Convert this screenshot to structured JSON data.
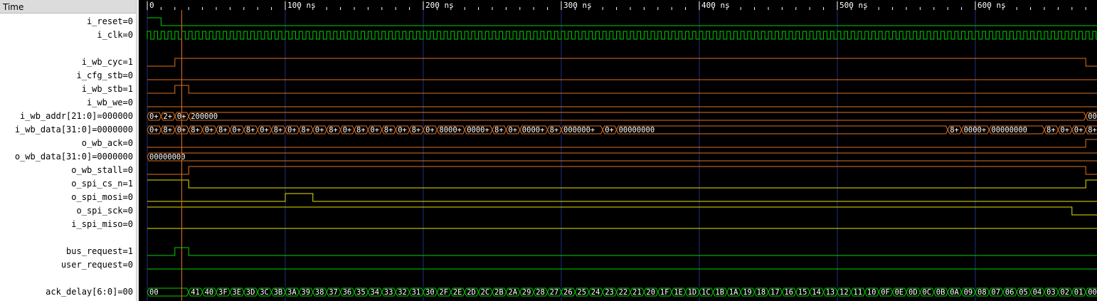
{
  "names_panel": {
    "header": "Time"
  },
  "signals": [
    {
      "label": "i_reset",
      "value": "0",
      "kind": "bit",
      "color": "#00d000",
      "row": 1,
      "transitions": [
        [
          0,
          1
        ],
        [
          10,
          0
        ]
      ]
    },
    {
      "label": "i_clk",
      "value": "0",
      "kind": "clock",
      "color": "#00d000",
      "row": 2,
      "period_ns": 5
    },
    {
      "label": "",
      "value": "",
      "kind": "blank",
      "row": 3
    },
    {
      "label": "i_wb_cyc",
      "value": "1",
      "kind": "bit",
      "color": "#e07020",
      "row": 4,
      "transitions": [
        [
          0,
          0
        ],
        [
          20,
          1
        ],
        [
          680,
          0
        ]
      ]
    },
    {
      "label": "i_cfg_stb",
      "value": "0",
      "kind": "bit",
      "color": "#e07020",
      "row": 5,
      "transitions": [
        [
          0,
          0
        ]
      ]
    },
    {
      "label": "i_wb_stb",
      "value": "1",
      "kind": "bit",
      "color": "#e07020",
      "row": 6,
      "transitions": [
        [
          0,
          0
        ],
        [
          20,
          1
        ],
        [
          30,
          0
        ]
      ]
    },
    {
      "label": "i_wb_we",
      "value": "0",
      "kind": "bit",
      "color": "#e07020",
      "row": 7,
      "transitions": [
        [
          0,
          0
        ]
      ]
    },
    {
      "label": "i_wb_addr[21:0]",
      "value": "000000",
      "kind": "bus",
      "color": "#e07020",
      "row": 8,
      "segments": [
        [
          0,
          "0+"
        ],
        [
          10,
          "2+"
        ],
        [
          20,
          "0+"
        ],
        [
          30,
          "200000"
        ],
        [
          680,
          "00"
        ]
      ]
    },
    {
      "label": "i_wb_data[31:0]",
      "value": "0000000",
      "kind": "bus",
      "color": "#e07020",
      "row": 9,
      "segments": [
        [
          0,
          "0+"
        ],
        [
          10,
          "8+"
        ],
        [
          20,
          "0+"
        ],
        [
          30,
          "8+"
        ],
        [
          40,
          "0+"
        ],
        [
          50,
          "8+"
        ],
        [
          60,
          "0+"
        ],
        [
          70,
          "8+"
        ],
        [
          80,
          "0+"
        ],
        [
          90,
          "8+"
        ],
        [
          100,
          "0+"
        ],
        [
          110,
          "8+"
        ],
        [
          120,
          "0+"
        ],
        [
          130,
          "8+"
        ],
        [
          140,
          "0+"
        ],
        [
          150,
          "8+"
        ],
        [
          160,
          "0+"
        ],
        [
          170,
          "8+"
        ],
        [
          180,
          "0+"
        ],
        [
          190,
          "8+"
        ],
        [
          200,
          "0+"
        ],
        [
          210,
          "8000+"
        ],
        [
          230,
          "0000+"
        ],
        [
          250,
          "8+"
        ],
        [
          260,
          "0+"
        ],
        [
          270,
          "0000+"
        ],
        [
          290,
          "8+"
        ],
        [
          300,
          "000000+"
        ],
        [
          330,
          "0+"
        ],
        [
          340,
          "00000000"
        ],
        [
          580,
          "8+"
        ],
        [
          590,
          "0000+"
        ],
        [
          610,
          "00000000"
        ],
        [
          650,
          "8+"
        ],
        [
          660,
          "0+"
        ],
        [
          670,
          "0+"
        ],
        [
          680,
          "8+"
        ]
      ]
    },
    {
      "label": "o_wb_ack",
      "value": "0",
      "kind": "bit",
      "color": "#e07020",
      "row": 10,
      "transitions": [
        [
          0,
          0
        ],
        [
          680,
          1
        ]
      ]
    },
    {
      "label": "o_wb_data[31:0]",
      "value": "0000000",
      "kind": "bus",
      "color": "#e07020",
      "row": 11,
      "segments": [
        [
          0,
          "00000000"
        ]
      ]
    },
    {
      "label": "o_wb_stall",
      "value": "0",
      "kind": "bit",
      "color": "#e07020",
      "row": 12,
      "transitions": [
        [
          0,
          0
        ],
        [
          30,
          1
        ],
        [
          680,
          0
        ]
      ]
    },
    {
      "label": "o_spi_cs_n",
      "value": "1",
      "kind": "bit",
      "color": "#e8e000",
      "row": 13,
      "transitions": [
        [
          0,
          1
        ],
        [
          30,
          0
        ],
        [
          680,
          1
        ]
      ]
    },
    {
      "label": "o_spi_mosi",
      "value": "0",
      "kind": "bit",
      "color": "#e8e000",
      "row": 14,
      "transitions": [
        [
          0,
          0
        ],
        [
          100,
          1
        ],
        [
          120,
          0
        ]
      ]
    },
    {
      "label": "o_spi_sck",
      "value": "0",
      "kind": "bit",
      "color": "#e8e000",
      "row": 15,
      "transitions": [
        [
          0,
          1
        ],
        [
          30,
          1
        ],
        [
          30,
          1
        ],
        [
          670,
          0
        ]
      ]
    },
    {
      "label": "i_spi_miso",
      "value": "0",
      "kind": "bit",
      "color": "#e8e000",
      "row": 16,
      "transitions": [
        [
          0,
          0
        ]
      ]
    },
    {
      "label": "",
      "value": "",
      "kind": "blank",
      "row": 17
    },
    {
      "label": "bus_request",
      "value": "1",
      "kind": "bit",
      "color": "#00d000",
      "row": 18,
      "transitions": [
        [
          0,
          0
        ],
        [
          20,
          1
        ],
        [
          30,
          0
        ]
      ]
    },
    {
      "label": "user_request",
      "value": "0",
      "kind": "bit",
      "color": "#00d000",
      "row": 19,
      "transitions": [
        [
          0,
          0
        ]
      ]
    },
    {
      "label": "",
      "value": "",
      "kind": "blank",
      "row": 20
    },
    {
      "label": "ack_delay[6:0]",
      "value": "00",
      "kind": "bus",
      "color": "#00d000",
      "row": 21,
      "segments": [
        [
          0,
          "00"
        ],
        [
          30,
          "41"
        ],
        [
          40,
          "40"
        ],
        [
          50,
          "3F"
        ],
        [
          60,
          "3E"
        ],
        [
          70,
          "3D"
        ],
        [
          80,
          "3C"
        ],
        [
          90,
          "3B"
        ],
        [
          100,
          "3A"
        ],
        [
          110,
          "39"
        ],
        [
          120,
          "38"
        ],
        [
          130,
          "37"
        ],
        [
          140,
          "36"
        ],
        [
          150,
          "35"
        ],
        [
          160,
          "34"
        ],
        [
          170,
          "33"
        ],
        [
          180,
          "32"
        ],
        [
          190,
          "31"
        ],
        [
          200,
          "30"
        ],
        [
          210,
          "2F"
        ],
        [
          220,
          "2E"
        ],
        [
          230,
          "2D"
        ],
        [
          240,
          "2C"
        ],
        [
          250,
          "2B"
        ],
        [
          260,
          "2A"
        ],
        [
          270,
          "29"
        ],
        [
          280,
          "28"
        ],
        [
          290,
          "27"
        ],
        [
          300,
          "26"
        ],
        [
          310,
          "25"
        ],
        [
          320,
          "24"
        ],
        [
          330,
          "23"
        ],
        [
          340,
          "22"
        ],
        [
          350,
          "21"
        ],
        [
          360,
          "20"
        ],
        [
          370,
          "1F"
        ],
        [
          380,
          "1E"
        ],
        [
          390,
          "1D"
        ],
        [
          400,
          "1C"
        ],
        [
          410,
          "1B"
        ],
        [
          420,
          "1A"
        ],
        [
          430,
          "19"
        ],
        [
          440,
          "18"
        ],
        [
          450,
          "17"
        ],
        [
          460,
          "16"
        ],
        [
          470,
          "15"
        ],
        [
          480,
          "14"
        ],
        [
          490,
          "13"
        ],
        [
          500,
          "12"
        ],
        [
          510,
          "11"
        ],
        [
          520,
          "10"
        ],
        [
          530,
          "0F"
        ],
        [
          540,
          "0E"
        ],
        [
          550,
          "0D"
        ],
        [
          560,
          "0C"
        ],
        [
          570,
          "0B"
        ],
        [
          580,
          "0A"
        ],
        [
          590,
          "09"
        ],
        [
          600,
          "08"
        ],
        [
          610,
          "07"
        ],
        [
          620,
          "06"
        ],
        [
          630,
          "05"
        ],
        [
          640,
          "04"
        ],
        [
          650,
          "03"
        ],
        [
          660,
          "02"
        ],
        [
          670,
          "01"
        ],
        [
          680,
          "00"
        ]
      ]
    }
  ],
  "timeline": {
    "ticks": [
      {
        "t": 0,
        "label": "0"
      },
      {
        "t": 100,
        "label": "100 ns"
      },
      {
        "t": 200,
        "label": "200 ns"
      },
      {
        "t": 300,
        "label": "300 ns"
      },
      {
        "t": 400,
        "label": "400 ns"
      },
      {
        "t": 500,
        "label": "500 ns"
      },
      {
        "t": 600,
        "label": "600 ns"
      }
    ],
    "view_end_ns": 690,
    "cursor_ns": 25
  },
  "colors": {
    "grid": "#203080",
    "cursor": "#e07020",
    "ruler_text": "#ffffff",
    "bus_text": "#ffffff"
  }
}
